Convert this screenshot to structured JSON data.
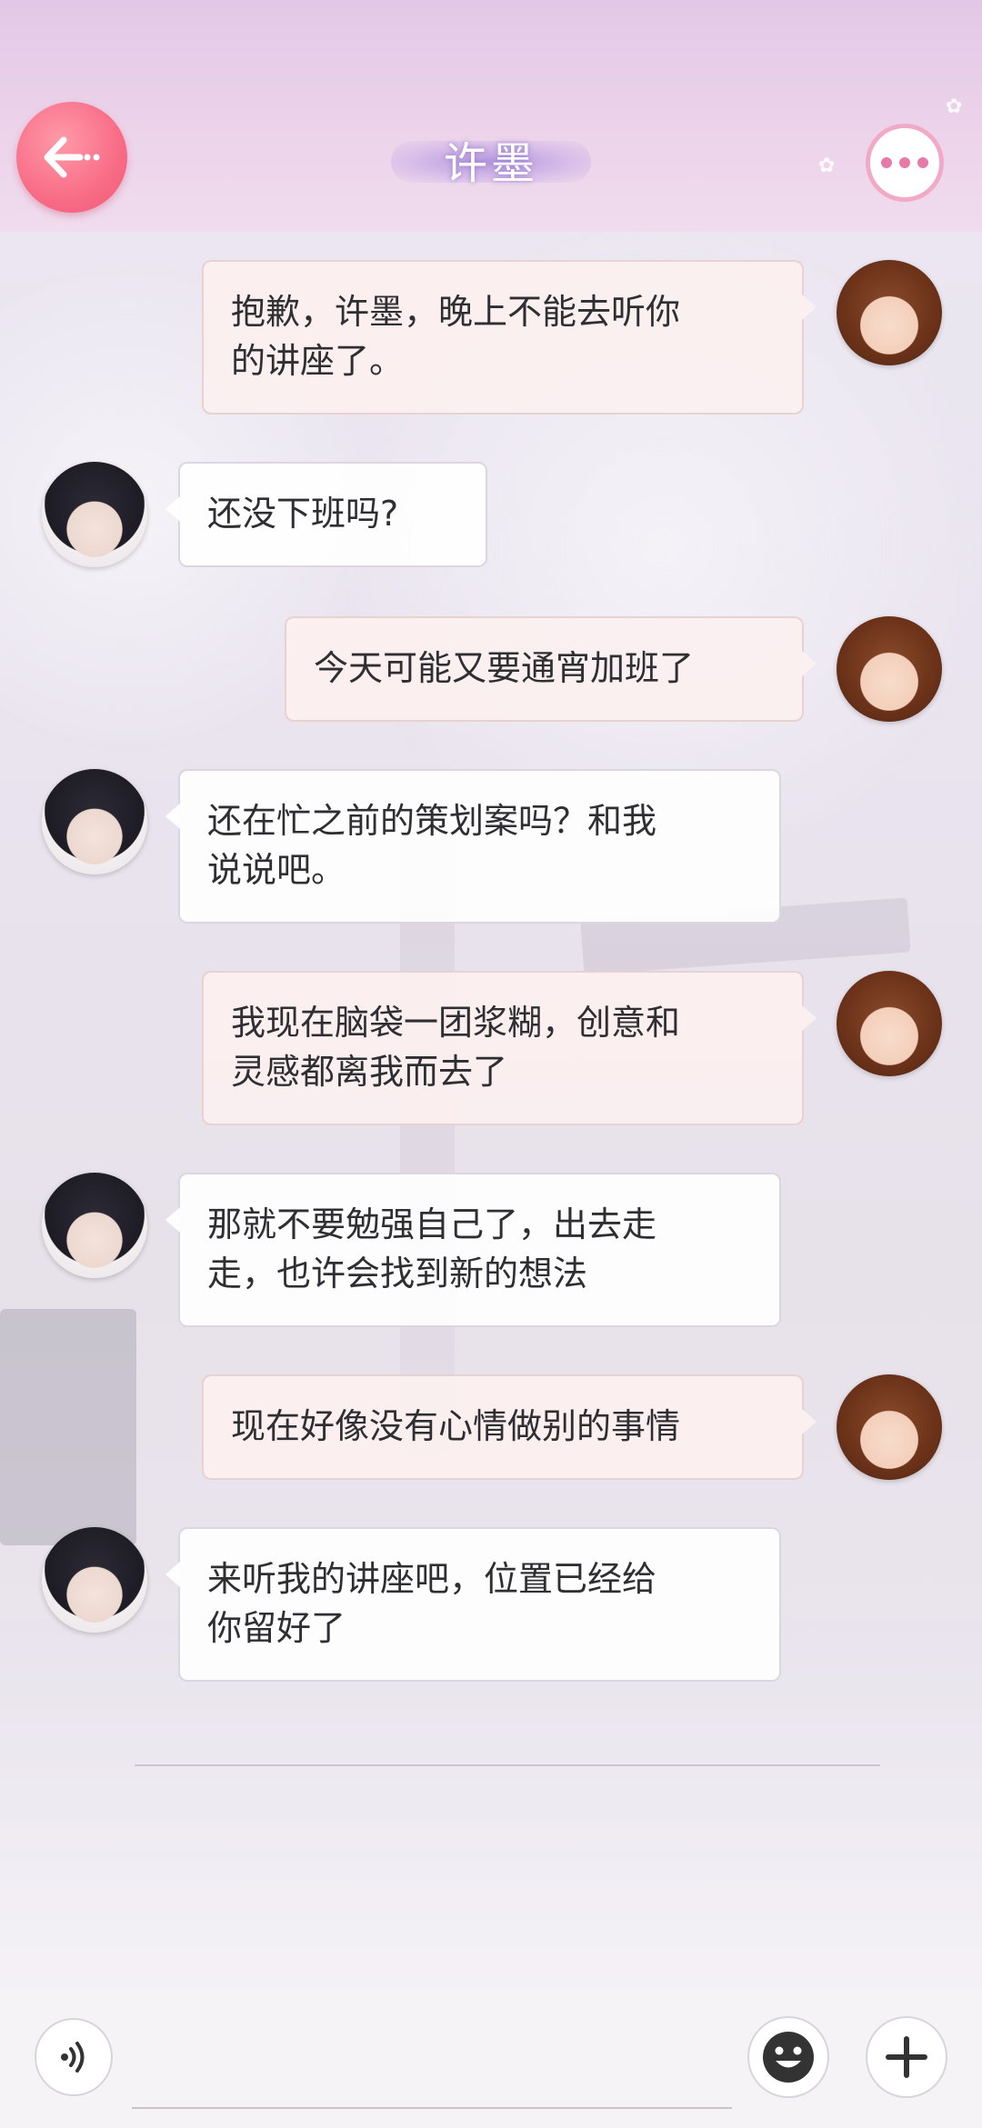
{
  "header": {
    "title": "许墨",
    "back_icon": "arrow-left-icon",
    "more_icon": "more-dots-icon",
    "accent_color": "#f86c86"
  },
  "messages": [
    {
      "sender": "me",
      "text_lines": [
        "抱歉，许墨，晚上不能去听你",
        "的讲座了。"
      ]
    },
    {
      "sender": "him",
      "text_lines": [
        "还没下班吗?"
      ]
    },
    {
      "sender": "me",
      "text_lines": [
        "今天可能又要通宵加班了"
      ]
    },
    {
      "sender": "him",
      "text_lines": [
        "还在忙之前的策划案吗？和我",
        "说说吧。"
      ]
    },
    {
      "sender": "me",
      "text_lines": [
        "我现在脑袋一团浆糊，创意和",
        "灵感都离我而去了"
      ]
    },
    {
      "sender": "him",
      "text_lines": [
        "那就不要勉强自己了，出去走",
        "走，也许会找到新的想法"
      ]
    },
    {
      "sender": "me",
      "text_lines": [
        "现在好像没有心情做别的事情"
      ]
    },
    {
      "sender": "him",
      "text_lines": [
        "来听我的讲座吧，位置已经给",
        "你留好了"
      ]
    }
  ],
  "input_bar": {
    "voice_icon": "voice-icon",
    "emoji_icon": "emoji-icon",
    "add_icon": "plus-icon"
  }
}
